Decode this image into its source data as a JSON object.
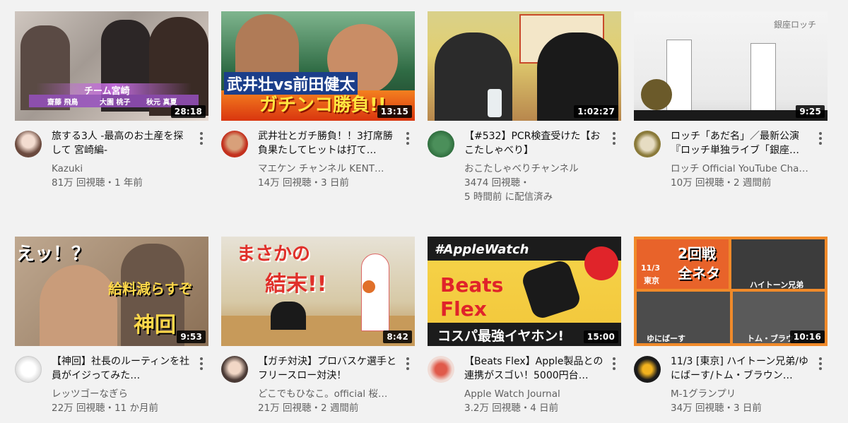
{
  "videos": [
    {
      "title": "旅する3人 -最高のお土産を探して 宮崎編-",
      "channel": "Kazuki",
      "stats": "81万 回視聴・1 年前",
      "duration": "28:18",
      "thumb_text": [
        "チーム宮崎",
        "齋藤 飛鳥",
        "大園 桃子",
        "秋元 真夏"
      ]
    },
    {
      "title": "武井壮とガチ勝負！！3打席勝負果たしてヒットは打て…",
      "channel": "マエケン チャンネル KENT…",
      "stats": "14万 回視聴・3 日前",
      "duration": "13:15",
      "thumb_text": [
        "武井壮vs前田健太",
        "ガチンコ勝負!!"
      ]
    },
    {
      "title": "【#532】PCR検査受けた【おこたしゃべり】",
      "channel": "おこたしゃべりチャンネル",
      "stats": "3474 回視聴・",
      "stats2": "5 時間前 に配信済み",
      "duration": "1:02:27",
      "thumb_text": []
    },
    {
      "title": "ロッチ「あだ名」／最新公演『ロッチ単独ライブ「銀座…",
      "channel": "ロッチ Official YouTube Cha…",
      "stats": "10万 回視聴・2 週間前",
      "duration": "9:25",
      "thumb_text": [
        "銀座ロッチ"
      ]
    },
    {
      "title": "【神回】社長のルーティンを社員がイジってみた…",
      "channel": "レッツゴーなぎら",
      "stats": "22万 回視聴・11 か月前",
      "duration": "9:53",
      "thumb_text": [
        "えッ！？",
        "給料減らすぞ",
        "神回"
      ]
    },
    {
      "title": "【ガチ対決】プロバスケ選手とフリースロー対決！",
      "channel": "どこでもひなこ。official 桜…",
      "stats": "21万 回視聴・2 週間前",
      "duration": "8:42",
      "thumb_text": [
        "まさかの",
        "結末!!"
      ]
    },
    {
      "title": "【Beats Flex】Apple製品との連携がスゴい！5000円台…",
      "channel": "Apple Watch Journal",
      "stats": "3.2万 回視聴・4 日前",
      "duration": "15:00",
      "thumb_text": [
        "#AppleWatch",
        "Beats",
        "Flex",
        "コスパ最強イヤホン!"
      ]
    },
    {
      "title": "11/3 [東京] ハイトーン兄弟/ゆにばーす/トム・ブラウン…",
      "channel": "M-1グランプリ",
      "stats": "34万 回視聴・3 日前",
      "duration": "10:16",
      "thumb_text": [
        "2回戦",
        "全ネタ",
        "11/3",
        "東京",
        "ハイトーン兄弟",
        "ゆにばーす",
        "トム・ブラウン"
      ]
    }
  ],
  "colors": {
    "primary_text": "#0f0f0f",
    "secondary_text": "#606060",
    "background": "#f2f2f2"
  },
  "icons": {
    "menu": "kebab-menu-icon"
  }
}
